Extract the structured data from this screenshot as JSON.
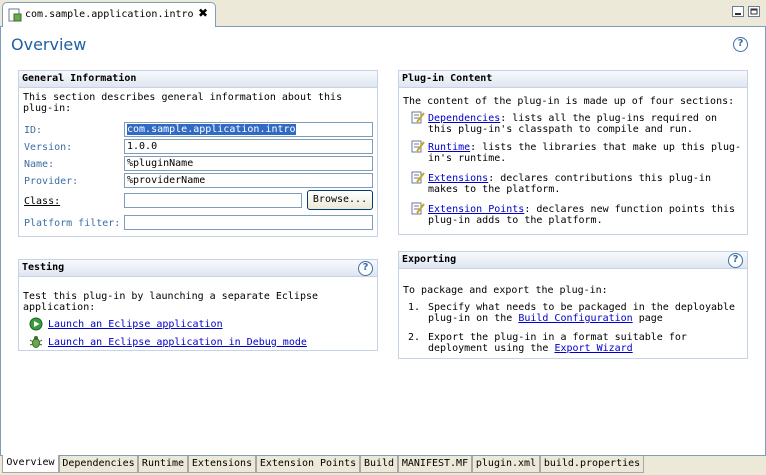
{
  "editor_tab": {
    "title": "com.sample.application.intro",
    "close_symbol": "✖"
  },
  "form_title": "Overview",
  "help_symbol": "?",
  "general": {
    "heading": "General Information",
    "description_line1": "This section describes general information about this",
    "description_line2": "plug-in:",
    "id_label": "ID:",
    "id_value": "com.sample.application.intro",
    "version_label": "Version:",
    "version_value": "1.0.0",
    "name_label": "Name:",
    "name_value": "%pluginName",
    "provider_label": "Provider:",
    "provider_value": "%providerName",
    "class_label": "Class:",
    "class_value": "",
    "browse_label": "Browse...",
    "platform_filter_label": "Platform filter:",
    "platform_filter_value": ""
  },
  "testing": {
    "heading": "Testing",
    "description_line1": "Test this plug-in by launching a separate Eclipse",
    "description_line2": "application:",
    "launch_link": "Launch an Eclipse application",
    "debug_link": "Launch an Eclipse application in Debug mode"
  },
  "content": {
    "heading": "Plug-in Content",
    "intro": "The content of the plug-in is made up of four sections:",
    "items": [
      {
        "link": "Dependencies",
        "line1": ": lists all the plug-ins required on",
        "line2": "this plug-in's classpath to compile and run."
      },
      {
        "link": "Runtime",
        "line1": ": lists the libraries that make up this plug-",
        "line2": "in's runtime."
      },
      {
        "link": "Extensions",
        "line1": ": declares contributions this plug-in",
        "line2": "makes to the platform."
      },
      {
        "link": "Extension Points",
        "line1": ": declares new function points this",
        "line2": "plug-in adds to the platform."
      }
    ]
  },
  "exporting": {
    "heading": "Exporting",
    "intro": "To package and export the plug-in:",
    "step1_num": "1.",
    "step1_line1": "Specify what needs to be packaged in the deployable",
    "step1_line2_pre": "plug-in on the ",
    "step1_link": "Build Configuration",
    "step1_line2_post": " page",
    "step2_num": "2.",
    "step2_line1": "Export the plug-in in a format suitable for",
    "step2_line2_pre": "deployment using the ",
    "step2_link": "Export Wizard"
  },
  "page_tabs": [
    "Overview",
    "Dependencies",
    "Runtime",
    "Extensions",
    "Extension Points",
    "Build",
    "MANIFEST.MF",
    "plugin.xml",
    "build.properties"
  ],
  "active_page_tab": "Overview",
  "colors": {
    "title": "#1f5fa5",
    "label": "#3a6ea5",
    "link": "#0000cc",
    "selection": "#316ac5"
  }
}
